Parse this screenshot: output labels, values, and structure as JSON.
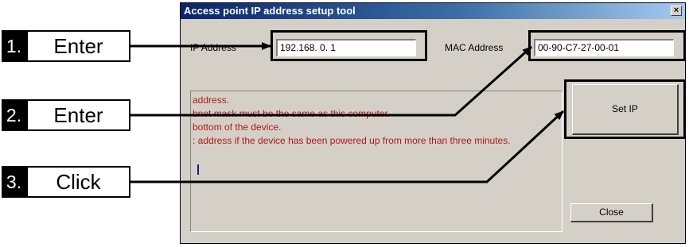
{
  "window": {
    "title": "Access point IP address setup tool",
    "close_glyph": "×"
  },
  "ip_address": {
    "label": "IP Address",
    "value": "192.168.  0.  1"
  },
  "mac_address": {
    "label": "MAC Address",
    "value": "00-90-C7-27-00-01"
  },
  "messages": [
    "address.",
    "bnet mask must be the same as this computer.",
    "bottom of the device.",
    ": address if the device has been powered up from more than three minutes."
  ],
  "buttons": {
    "set_ip": "Set IP",
    "close": "Close"
  },
  "steps": [
    {
      "number": "1.",
      "action": "Enter"
    },
    {
      "number": "2.",
      "action": "Enter"
    },
    {
      "number": "3.",
      "action": "Click"
    }
  ],
  "colors": {
    "title_bar": "#0a246a",
    "message_text": "#b01818",
    "window_bg": "#d4d0c8"
  }
}
